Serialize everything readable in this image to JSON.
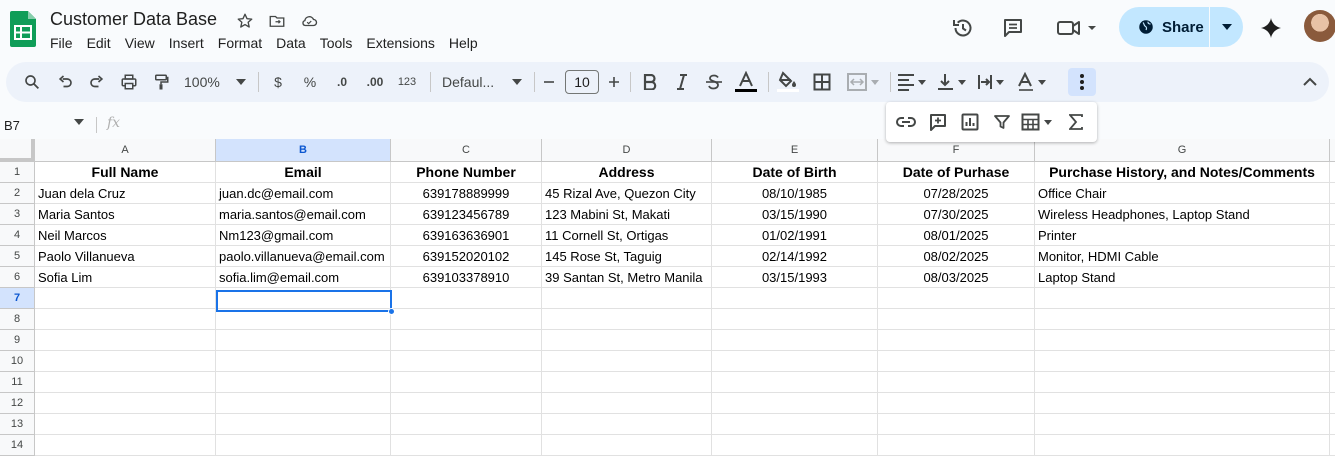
{
  "doc": {
    "title": "Customer Data Base"
  },
  "menu": [
    "File",
    "Edit",
    "View",
    "Insert",
    "Format",
    "Data",
    "Tools",
    "Extensions",
    "Help"
  ],
  "share": {
    "label": "Share"
  },
  "toolbar": {
    "zoom": "100%",
    "currency": "$",
    "percent": "%",
    "decrease_decimal": ".0",
    "increase_decimal": ".00",
    "number_format": "123",
    "font": "Defaul...",
    "font_size": "10"
  },
  "formula_bar": {
    "cell_ref": "B7",
    "fx": "fx"
  },
  "columns": [
    "A",
    "B",
    "C",
    "D",
    "E",
    "F",
    "G"
  ],
  "rows": [
    "1",
    "2",
    "3",
    "4",
    "5",
    "6",
    "7",
    "8",
    "9",
    "10",
    "11",
    "12",
    "13",
    "14"
  ],
  "sheet": {
    "header": [
      "Full Name",
      "Email",
      "Phone Number",
      "Address",
      "Date of Birth",
      "Date of Purhase",
      "Purchase History, and Notes/Comments"
    ],
    "data": [
      [
        "Juan dela Cruz",
        "juan.dc@email.com",
        "639178889999",
        "45 Rizal Ave, Quezon City",
        "08/10/1985",
        "07/28/2025",
        "Office Chair"
      ],
      [
        "Maria Santos",
        "maria.santos@email.com",
        "639123456789",
        "123 Mabini St, Makati",
        "03/15/1990",
        "07/30/2025",
        "Wireless Headphones, Laptop Stand"
      ],
      [
        "Neil Marcos",
        "Nm123@gmail.com",
        "639163636901",
        "11 Cornell St, Ortigas",
        "01/02/1991",
        "08/01/2025",
        "Printer"
      ],
      [
        "Paolo Villanueva",
        "paolo.villanueva@email.com",
        "639152020102",
        "145 Rose St, Taguig",
        "02/14/1992",
        "08/02/2025",
        "Monitor, HDMI Cable"
      ],
      [
        "Sofia Lim",
        "sofia.lim@email.com",
        "639103378910",
        "39 Santan St, Metro Manila",
        "03/15/1993",
        "08/03/2025",
        "Laptop Stand"
      ]
    ]
  },
  "colors": {
    "accent": "#1a73e8",
    "share_bg": "#c2e7ff",
    "toolbar_bg": "#edf2fa",
    "selected_header": "#d3e3fd",
    "logo_green": "#0f9d58"
  }
}
